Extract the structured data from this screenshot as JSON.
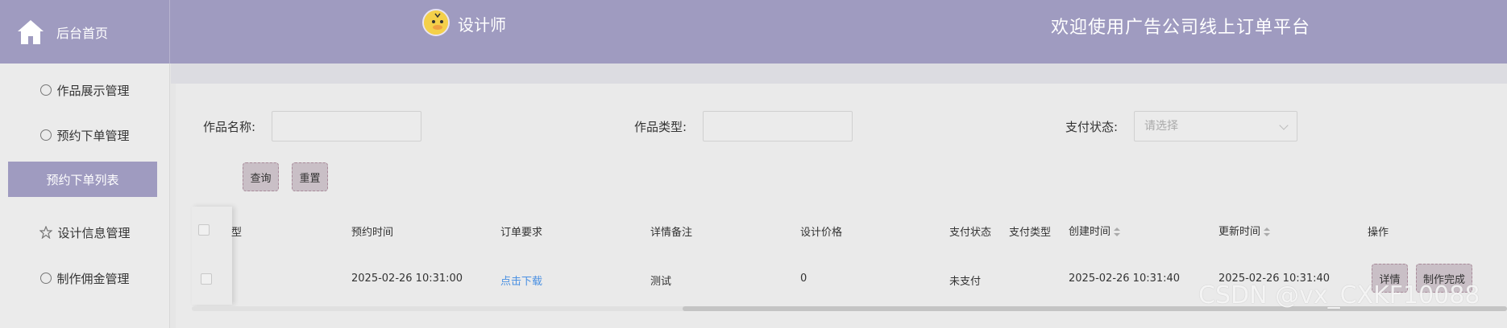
{
  "header": {
    "home_label": "后台首页",
    "role": "设计师",
    "welcome": "欢迎使用广告公司线上订单平台"
  },
  "sidebar": {
    "items": [
      {
        "label": "作品展示管理",
        "icon": "timer-icon"
      },
      {
        "label": "预约下单管理",
        "icon": "pie-icon"
      },
      {
        "label": "预约下单列表",
        "active": true
      },
      {
        "label": "设计信息管理",
        "icon": "star-icon"
      },
      {
        "label": "制作佣金管理",
        "icon": "compass-icon"
      }
    ]
  },
  "filters": {
    "work_name_label": "作品名称:",
    "work_type_label": "作品类型:",
    "pay_status_label": "支付状态:",
    "pay_status_placeholder": "请选择"
  },
  "actions": {
    "query": "查询",
    "reset": "重置"
  },
  "table": {
    "columns": {
      "type_partial": "型",
      "booking_time": "预约时间",
      "order_req": "订单要求",
      "detail_note": "详情备注",
      "design_price": "设计价格",
      "pay_status": "支付状态",
      "pay_type": "支付类型",
      "created_at": "创建时间",
      "updated_at": "更新时间",
      "operation": "操作"
    },
    "rows": [
      {
        "booking_time": "2025-02-26 10:31:00",
        "order_req": "点击下载",
        "detail_note": "测试",
        "design_price": "0",
        "pay_status": "未支付",
        "pay_type": "",
        "created_at": "2025-02-26 10:31:40",
        "updated_at": "2025-02-26 10:31:40",
        "detail_btn": "详情",
        "finish_btn": "制作完成"
      }
    ]
  },
  "watermark": "CSDN @vx_CXKF10088",
  "colors": {
    "header_bg": "#9f9bc0",
    "link": "#4a90e2",
    "button_bg": "#c9bfc6"
  }
}
